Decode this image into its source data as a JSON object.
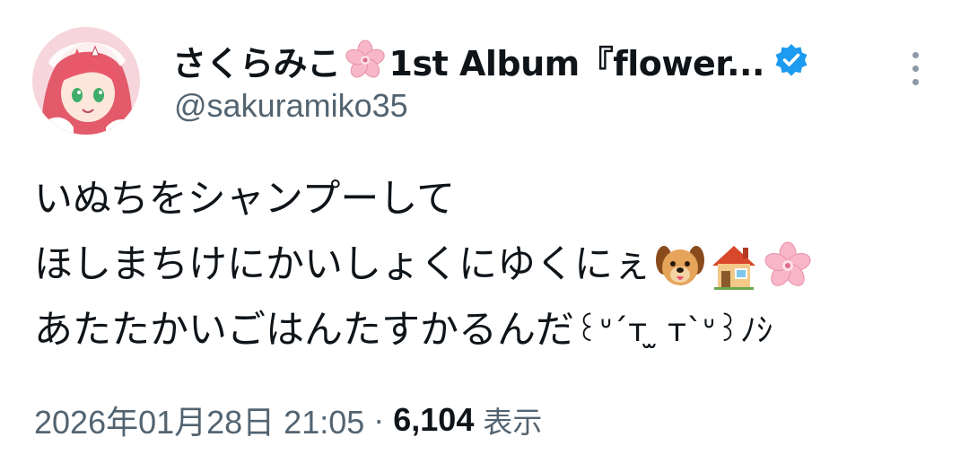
{
  "author": {
    "display_name_prefix": "さくらみこ",
    "display_name_suffix": "1st Album『flower...",
    "name_emoji": "cherry-blossom",
    "handle": "@sakuramiko35",
    "verified": true,
    "verified_color": "#1d9bf0",
    "avatar_icon": "avatar-image"
  },
  "tweet": {
    "lines": [
      {
        "text": "いぬちをシャンプーして",
        "emojis": []
      },
      {
        "text": "ほしまちけにかいしょくにゆくにぇ",
        "emojis": [
          "dog-face",
          "house",
          "cherry-blossom"
        ]
      },
      {
        "text": "あたたかいごはんたすかるんだ",
        "kaomoji": "꒰ᐡ´т ̫ т`ᐡ꒱ﾉｼ",
        "emojis": []
      }
    ]
  },
  "meta": {
    "timestamp": "2026年01月28日 21:05",
    "separator": "·",
    "views_count": "6,104",
    "views_label": "表示"
  },
  "colors": {
    "text_primary": "#0f1419",
    "text_secondary": "#536471",
    "accent": "#1d9bf0"
  }
}
